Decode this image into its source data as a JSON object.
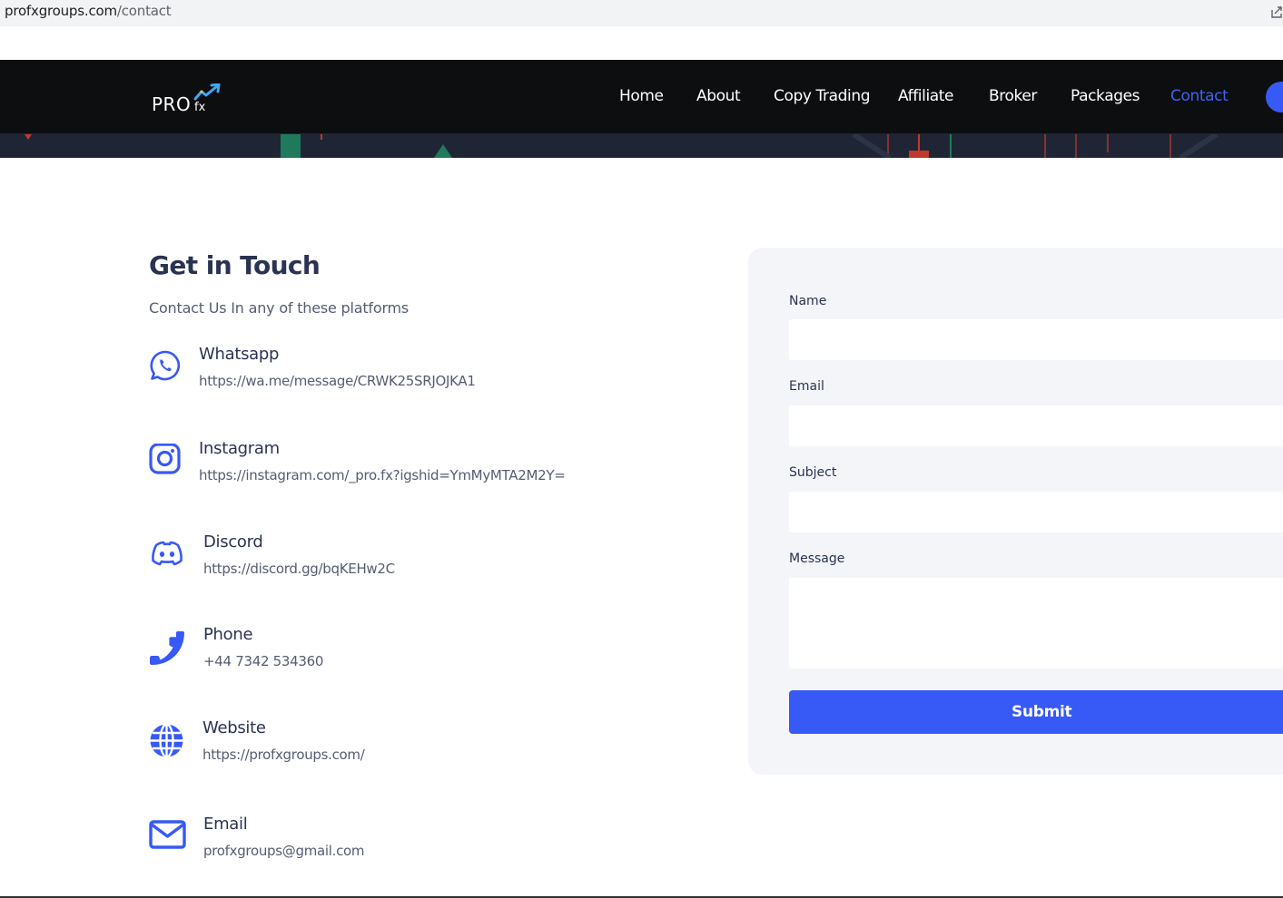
{
  "browser": {
    "url_domain": "profxgroups.com",
    "url_path": "/contact"
  },
  "header": {
    "logo_text": "PRO",
    "logo_sub": "fx",
    "nav": [
      {
        "label": "Home"
      },
      {
        "label": "About"
      },
      {
        "label": "Copy Trading"
      },
      {
        "label": "Affiliate"
      },
      {
        "label": "Broker"
      },
      {
        "label": "Packages"
      },
      {
        "label": "Contact",
        "active": true
      }
    ]
  },
  "contact": {
    "title": "Get in Touch",
    "subtitle": "Contact Us In any of these platforms",
    "items": [
      {
        "label": "Whatsapp",
        "value": "https://wa.me/message/CRWK25SRJOJKA1",
        "icon": "whatsapp-icon"
      },
      {
        "label": "Instagram",
        "value": "https://instagram.com/_pro.fx?igshid=YmMyMTA2M2Y=",
        "icon": "instagram-icon"
      },
      {
        "label": "Discord",
        "value": "https://discord.gg/bqKEHw2C",
        "icon": "discord-icon"
      },
      {
        "label": "Phone",
        "value": "+44 7342 534360",
        "icon": "phone-icon"
      },
      {
        "label": "Website",
        "value": "https://profxgroups.com/",
        "icon": "globe-icon"
      },
      {
        "label": "Email",
        "value": "profxgroups@gmail.com",
        "icon": "envelope-icon"
      }
    ]
  },
  "form": {
    "name_label": "Name",
    "email_label": "Email",
    "subject_label": "Subject",
    "message_label": "Message",
    "name_value": "",
    "email_value": "",
    "subject_value": "",
    "message_value": "",
    "submit_label": "Submit"
  },
  "colors": {
    "accent": "#3759f5",
    "nav_bg": "#0d0e10",
    "heading": "#2b3352",
    "card_bg": "#f4f5f9"
  }
}
